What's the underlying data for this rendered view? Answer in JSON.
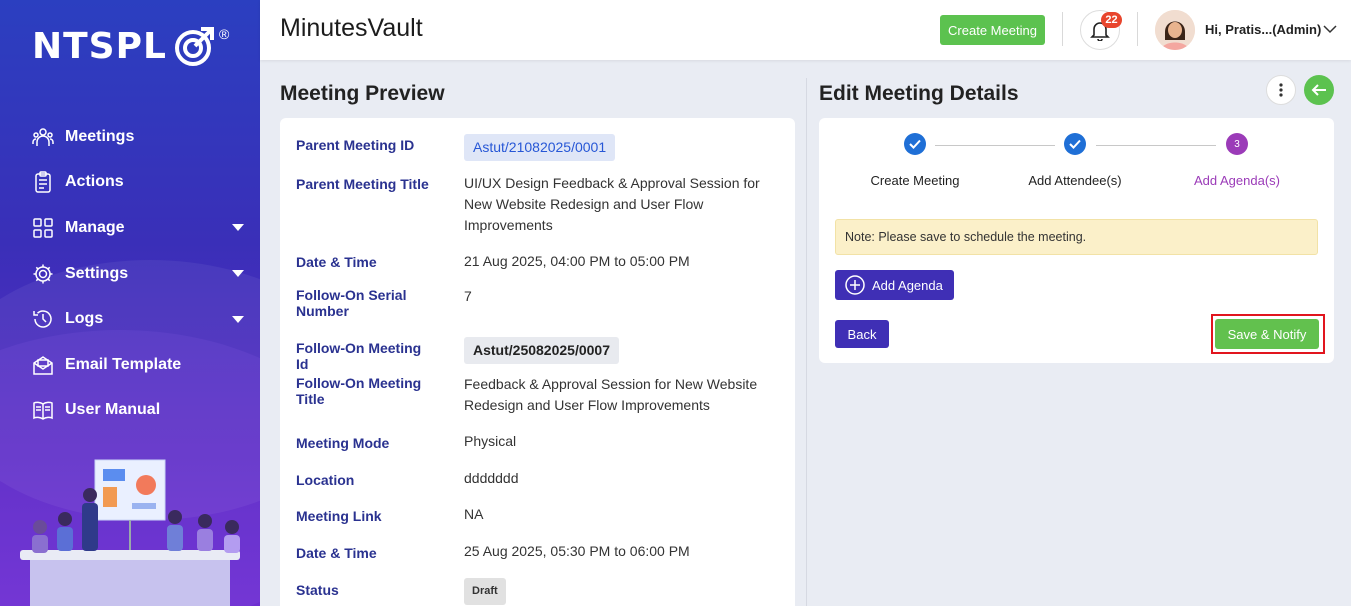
{
  "brand": {
    "logo_text": "NTSPL",
    "registered": "®"
  },
  "sidebar": {
    "items": [
      {
        "label": "Meetings",
        "icon": "meetings-icon"
      },
      {
        "label": "Actions",
        "icon": "clipboard-icon"
      },
      {
        "label": "Manage",
        "icon": "grid-icon",
        "has_submenu": true
      },
      {
        "label": "Settings",
        "icon": "gear-icon",
        "has_submenu": true
      },
      {
        "label": "Logs",
        "icon": "history-icon",
        "has_submenu": true
      },
      {
        "label": "Email Template",
        "icon": "mail-icon"
      },
      {
        "label": "User Manual",
        "icon": "book-icon"
      }
    ]
  },
  "header": {
    "app_title": "MinutesVault",
    "create_meeting_label": "Create Meeting",
    "notification_count": "22",
    "user_name": "Hi, Pratis...(Admin)"
  },
  "preview": {
    "title": "Meeting Preview",
    "rows": [
      {
        "label": "Parent Meeting ID",
        "value": "Astut/21082025/0001"
      },
      {
        "label": "Parent Meeting Title",
        "value": "UI/UX Design Feedback & Approval Session for New Website Redesign and User Flow Improvements"
      },
      {
        "label": "Date & Time",
        "value": "21 Aug 2025, 04:00 PM to 05:00 PM"
      },
      {
        "label": "Follow-On Serial Number",
        "value": "7"
      },
      {
        "label": "Follow-On Meeting Id",
        "value": "Astut/25082025/0007"
      },
      {
        "label": "Follow-On Meeting Title",
        "value": "Feedback & Approval Session for New Website Redesign and User Flow Improvements"
      },
      {
        "label": "Meeting Mode",
        "value": "Physical"
      },
      {
        "label": "Location",
        "value": "ddddddd"
      },
      {
        "label": "Meeting Link",
        "value": "NA"
      },
      {
        "label": "Date & Time",
        "value": "25 Aug 2025, 05:30 PM to 06:00 PM"
      },
      {
        "label": "Status",
        "value": "Draft"
      }
    ]
  },
  "edit": {
    "title": "Edit Meeting Details",
    "steps": [
      {
        "label": "Create Meeting",
        "state": "done"
      },
      {
        "label": "Add Attendee(s)",
        "state": "done"
      },
      {
        "label": "Add Agenda(s)",
        "state": "current",
        "number": "3"
      }
    ],
    "note": "Note: Please save to schedule the meeting.",
    "add_agenda_label": "Add Agenda",
    "back_label": "Back",
    "save_label": "Save & Notify"
  },
  "colors": {
    "primary": "#3f2fb5",
    "success": "#62c14e",
    "link": "#2a3290",
    "step_done": "#1f6fd6",
    "step_current": "#9b3bb8",
    "highlight": "#e1151e"
  }
}
